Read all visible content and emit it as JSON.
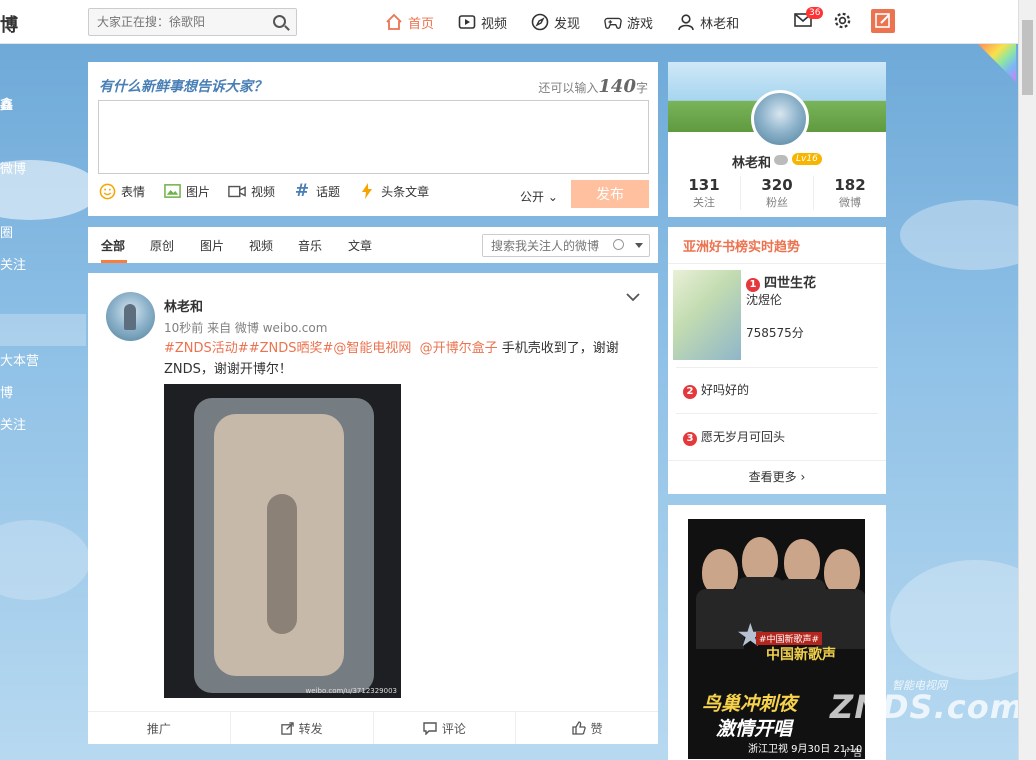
{
  "top": {
    "logo": "博",
    "search_placeholder": "大家正在搜：徐歌阳",
    "nav": [
      {
        "label": "首页",
        "icon": "home-icon"
      },
      {
        "label": "视频",
        "icon": "video-icon"
      },
      {
        "label": "发现",
        "icon": "compass-icon"
      },
      {
        "label": "游戏",
        "icon": "gamepad-icon"
      },
      {
        "label": "林老和",
        "icon": "user-icon"
      }
    ],
    "message_badge": "36"
  },
  "leftnav": [
    "鑫",
    "",
    "微博",
    "",
    "圈",
    "关注",
    "",
    "",
    "大本营",
    "博",
    "关注"
  ],
  "publisher": {
    "prompt": "有什么新鲜事想告诉大家？",
    "count_prefix": "还可以输入",
    "count_num": "140",
    "count_suffix": "字",
    "tools": [
      "表情",
      "图片",
      "视频",
      "话题",
      "头条文章"
    ],
    "visibility": "公开",
    "publish": "发布"
  },
  "tabs": {
    "items": [
      "全部",
      "原创",
      "图片",
      "视频",
      "音乐",
      "文章"
    ],
    "search_placeholder": "搜索我关注人的微博"
  },
  "post": {
    "author": "林老和",
    "meta": "10秒前 来自 微博 weibo.com",
    "topic1": "#ZNDS活动#",
    "topic2": "#ZNDS晒奖#",
    "mention1": "@智能电视网",
    "mention2": "@开博尔盒子",
    "body_a": " 手机壳收到了，谢谢",
    "body_b": "ZNDS，谢谢开博尔！",
    "watermark": "weibo.com/u/3712329003",
    "actions": [
      "推广",
      "转发",
      "评论",
      "赞"
    ]
  },
  "profile": {
    "name": "林老和",
    "level": "Lv16",
    "stats": [
      {
        "num": "131",
        "label": "关注"
      },
      {
        "num": "320",
        "label": "粉丝"
      },
      {
        "num": "182",
        "label": "微博"
      }
    ]
  },
  "trend": {
    "title": "亚洲好书榜实时趋势",
    "top": {
      "rank": "1",
      "title": "四世生花",
      "author": "沈煜伦",
      "score": "758575分"
    },
    "items": [
      {
        "rank": "2",
        "title": "好吗好的"
      },
      {
        "rank": "3",
        "title": "愿无岁月可回头"
      }
    ],
    "more": "查看更多"
  },
  "ad": {
    "tag": "#中国新歌声#",
    "show": "中国新歌声",
    "line1": "鸟巢冲刺夜",
    "line2": "激情开唱",
    "time": "浙江卫视 9月30日 21:10",
    "label": "广告"
  },
  "watermark": {
    "brand": "ZNDS.com",
    "cn": "智能电视网"
  },
  "colors": {
    "accent": "#eb7350",
    "link": "#4a7fb5",
    "bg": "#8ec0e6"
  }
}
